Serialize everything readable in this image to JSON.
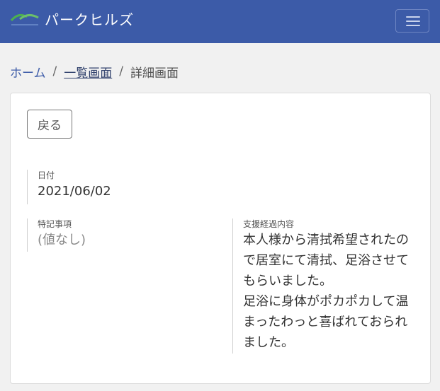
{
  "navbar": {
    "brand": "パークヒルズ",
    "logo_icon": "park-hills-logo-icon",
    "menu_icon": "hamburger-menu-icon",
    "color": "#3c5ba8"
  },
  "breadcrumb": {
    "home": "ホーム",
    "list": "一覧画面",
    "current": "詳細画面",
    "separator": "/"
  },
  "card": {
    "back_label": "戻る",
    "date": {
      "label": "日付",
      "value": "2021/06/02"
    },
    "notes": {
      "label": "特記事項",
      "value": "(値なし)"
    },
    "progress": {
      "label": "支援経過内容",
      "value": "本人様から清拭希望されたので居室にて清拭、足浴させてもらいました。\n足浴に身体がポカポカして温まったわっと喜ばれておられました。"
    }
  }
}
